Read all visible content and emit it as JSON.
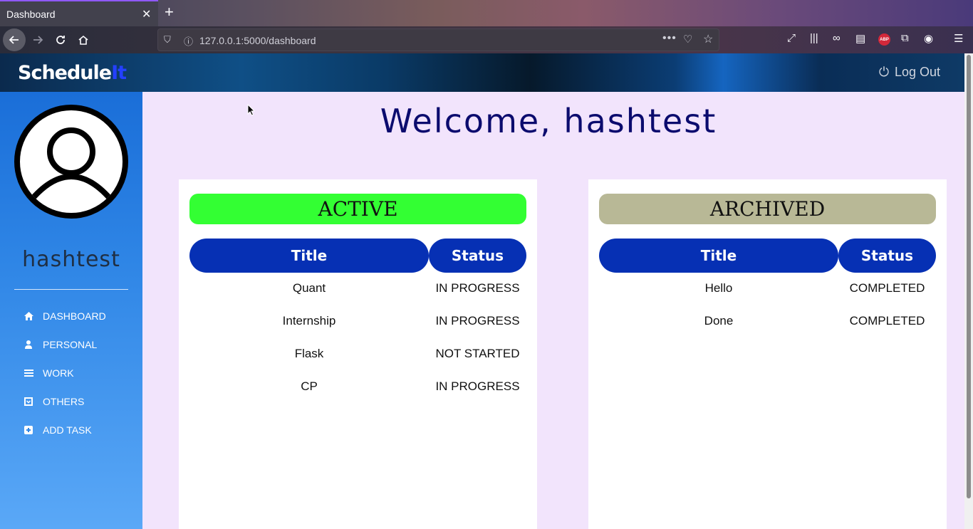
{
  "browser": {
    "tab_title": "Dashboard",
    "tab_close": "✕",
    "new_tab": "+",
    "url": "127.0.0.1:5000/dashboard",
    "url_dots": "•••"
  },
  "app": {
    "brand_main": "Schedule",
    "brand_accent": "It",
    "logout_label": "Log Out"
  },
  "sidebar": {
    "username": "hashtest",
    "items": [
      {
        "label": "DASHBOARD",
        "icon": "home-icon"
      },
      {
        "label": "PERSONAL",
        "icon": "user-icon"
      },
      {
        "label": "WORK",
        "icon": "list-icon"
      },
      {
        "label": "OTHERS",
        "icon": "box-icon"
      },
      {
        "label": "ADD TASK",
        "icon": "plus-square-icon"
      }
    ]
  },
  "main": {
    "welcome": "Welcome, hashtest",
    "active": {
      "heading": "ACTIVE",
      "heading_color": "#33ff33",
      "col_title": "Title",
      "col_status": "Status",
      "rows": [
        {
          "title": "Quant",
          "status": "IN PROGRESS"
        },
        {
          "title": "Internship",
          "status": "IN PROGRESS"
        },
        {
          "title": "Flask",
          "status": "NOT STARTED"
        },
        {
          "title": "CP",
          "status": "IN PROGRESS"
        }
      ]
    },
    "archived": {
      "heading": "ARCHIVED",
      "heading_color": "#b8b896",
      "col_title": "Title",
      "col_status": "Status",
      "rows": [
        {
          "title": "Hello",
          "status": "COMPLETED"
        },
        {
          "title": "Done",
          "status": "COMPLETED"
        }
      ]
    }
  },
  "colors": {
    "header_blue": "#0630b4",
    "welcome_text": "#0b0b6e",
    "main_bg": "#f2e4fc"
  }
}
